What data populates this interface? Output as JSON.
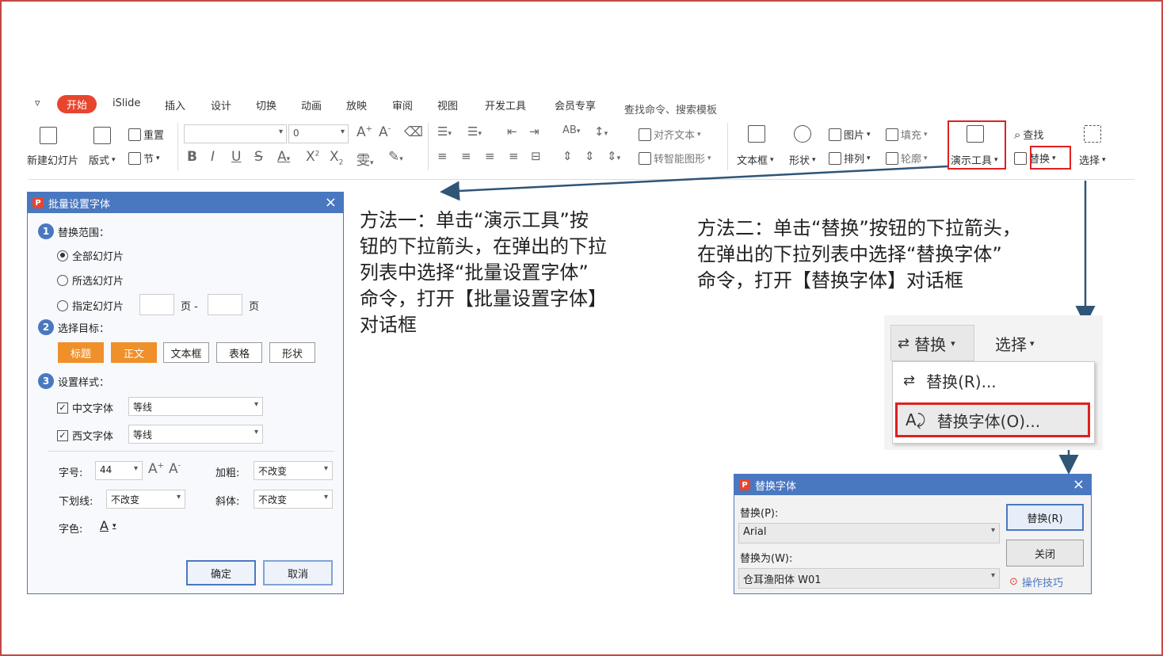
{
  "ribbon": {
    "quick_icon": "▿",
    "tabs": [
      "开始",
      "iSlide",
      "插入",
      "设计",
      "切换",
      "动画",
      "放映",
      "审阅",
      "视图",
      "开发工具",
      "会员专享"
    ],
    "search_label": "查找命令、搜索模板",
    "new_slide": "新建幻灯片",
    "layout": "版式",
    "reset": "重置",
    "section": "节",
    "font_size_value": "0",
    "align_text": "对齐文本",
    "smartart": "转智能图形",
    "textbox": "文本框",
    "shape": "形状",
    "picture": "图片",
    "arrange": "排列",
    "fill": "填充",
    "outline": "轮廓",
    "demo_tools": "演示工具",
    "find": "查找",
    "replace": "替换",
    "select": "选择"
  },
  "batch_dialog": {
    "title": "批量设置字体",
    "step1": "替换范围：",
    "all_slides": "全部幻灯片",
    "selected_slides": "所选幻灯片",
    "specified_slides": "指定幻灯片",
    "page1": "页 -",
    "page2": "页",
    "step2": "选择目标：",
    "targets": [
      "标题",
      "正文",
      "文本框",
      "表格",
      "形状"
    ],
    "step3": "设置样式：",
    "cn_font_label": "中文字体",
    "cn_font_value": "等线",
    "west_font_label": "西文字体",
    "west_font_value": "等线",
    "size_label": "字号:",
    "size_value": "44",
    "bold_label": "加粗:",
    "bold_value": "不改变",
    "underline_label": "下划线:",
    "underline_value": "不改变",
    "italic_label": "斜体:",
    "italic_value": "不改变",
    "color_label": "字色:",
    "ok": "确定",
    "cancel": "取消"
  },
  "annotation1": [
    "方法一：单击“演示工具”按",
    "钮的下拉箭头，在弹出的下拉",
    "列表中选择“批量设置字体”",
    "命令，打开【批量设置字体】",
    "对话框"
  ],
  "annotation2": [
    "方法二：单击“替换”按钮的下拉箭头，",
    "在弹出的下拉列表中选择“替换字体”",
    "命令，打开【替换字体】对话框"
  ],
  "zoom_menu": {
    "replace_button": "替换",
    "select_button": "选择",
    "replace_item": "替换(R)...",
    "replace_font_item": "替换字体(O)..."
  },
  "replace_dialog": {
    "title": "替换字体",
    "replace_label": "替换(P):",
    "replace_value": "Arial",
    "with_label": "替换为(W):",
    "with_value": "仓耳渔阳体 W01",
    "replace_button": "替换(R)",
    "close_button": "关闭",
    "tips": "操作技巧"
  },
  "colors": {
    "accent": "#4a78c0",
    "brand": "#e8452e",
    "highlight": "#e02020",
    "orange": "#f0902a"
  }
}
